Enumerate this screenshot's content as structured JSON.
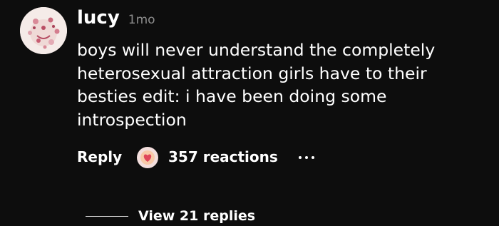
{
  "comment": {
    "avatar_icon": "avatar-image",
    "username": "lucy",
    "timestamp": "1mo",
    "text": "boys will never understand the completely heterosexual attraction girls have to their besties edit: i have been doing some introspection",
    "actions": {
      "reply_label": "Reply",
      "reaction_icon": "heart-face-emoji-icon",
      "reactions_label": "357 reactions",
      "more_icon": "more-options-icon"
    },
    "replies_label": "View 21 replies"
  },
  "colors": {
    "background": "#0d0d0d",
    "text_primary": "#ffffff",
    "text_secondary": "#8d8d8d",
    "reaction_accent": "#e0465a"
  }
}
